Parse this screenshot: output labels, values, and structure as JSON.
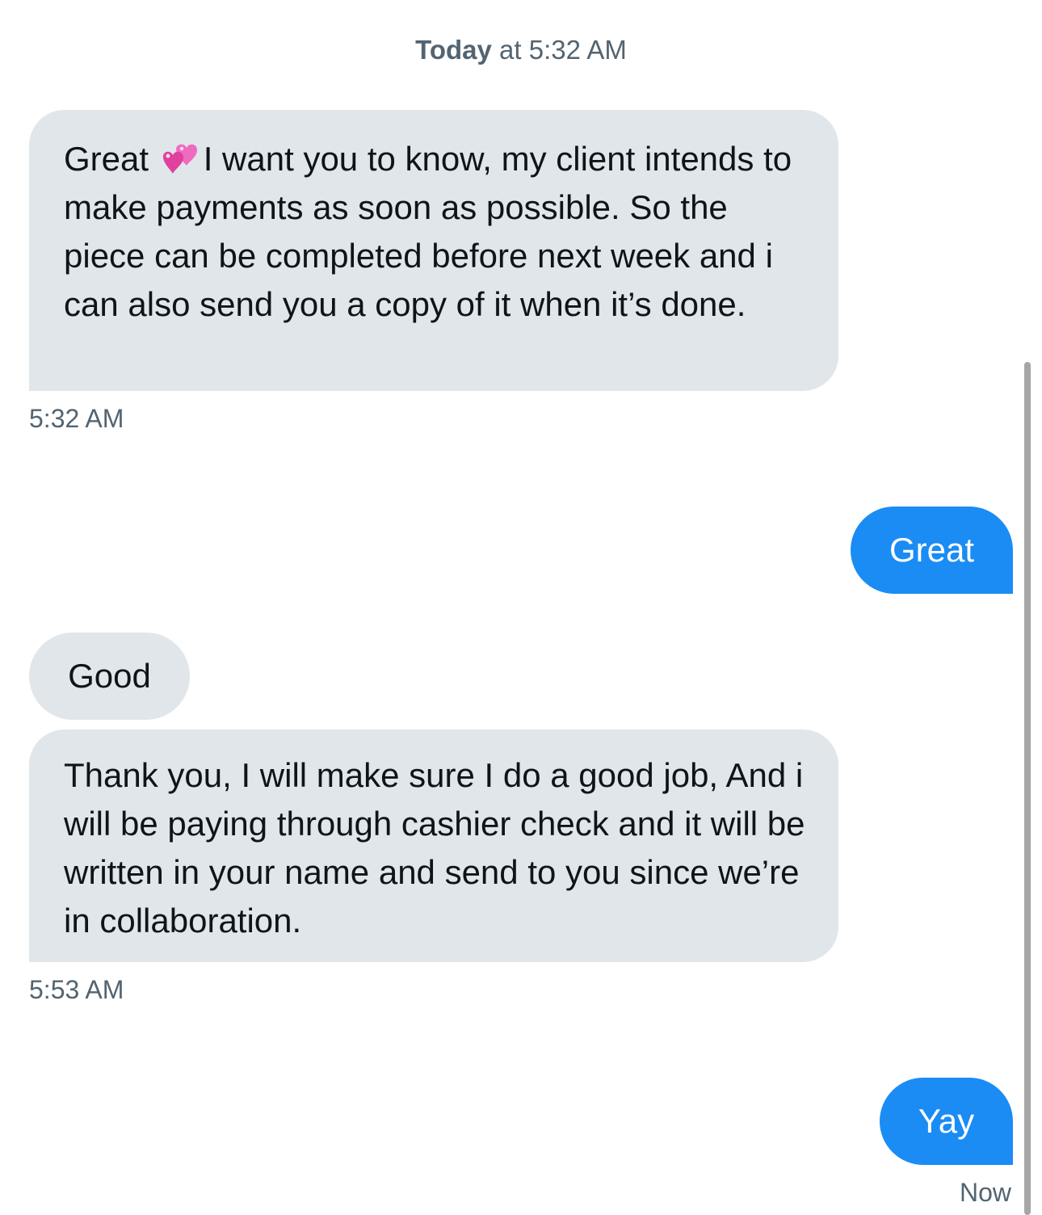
{
  "header": {
    "day": "Today",
    "rest": " at 5:32 AM"
  },
  "messages": [
    {
      "text_before_emoji": "Great ",
      "emoji_icon": "two-hearts-emoji",
      "text_after_emoji": "I want you to know, my client intends to make payments as soon as possible. So the piece can be completed before next week and i can also send you a copy of it when it’s done.",
      "timestamp": "5:32 AM"
    },
    {
      "text": "Great"
    },
    {
      "text": "Good"
    },
    {
      "text": "Thank you, I will make sure I do a good job, And i will be paying through cashier check and it will be written in your name and send to you since we’re in collaboration.",
      "timestamp": "5:53 AM"
    },
    {
      "text": "Yay",
      "timestamp": "Now"
    }
  ],
  "colors": {
    "incoming_bubble": "#e1e6ea",
    "outgoing_bubble": "#1a8cf4",
    "timestamp_text": "#536471"
  }
}
